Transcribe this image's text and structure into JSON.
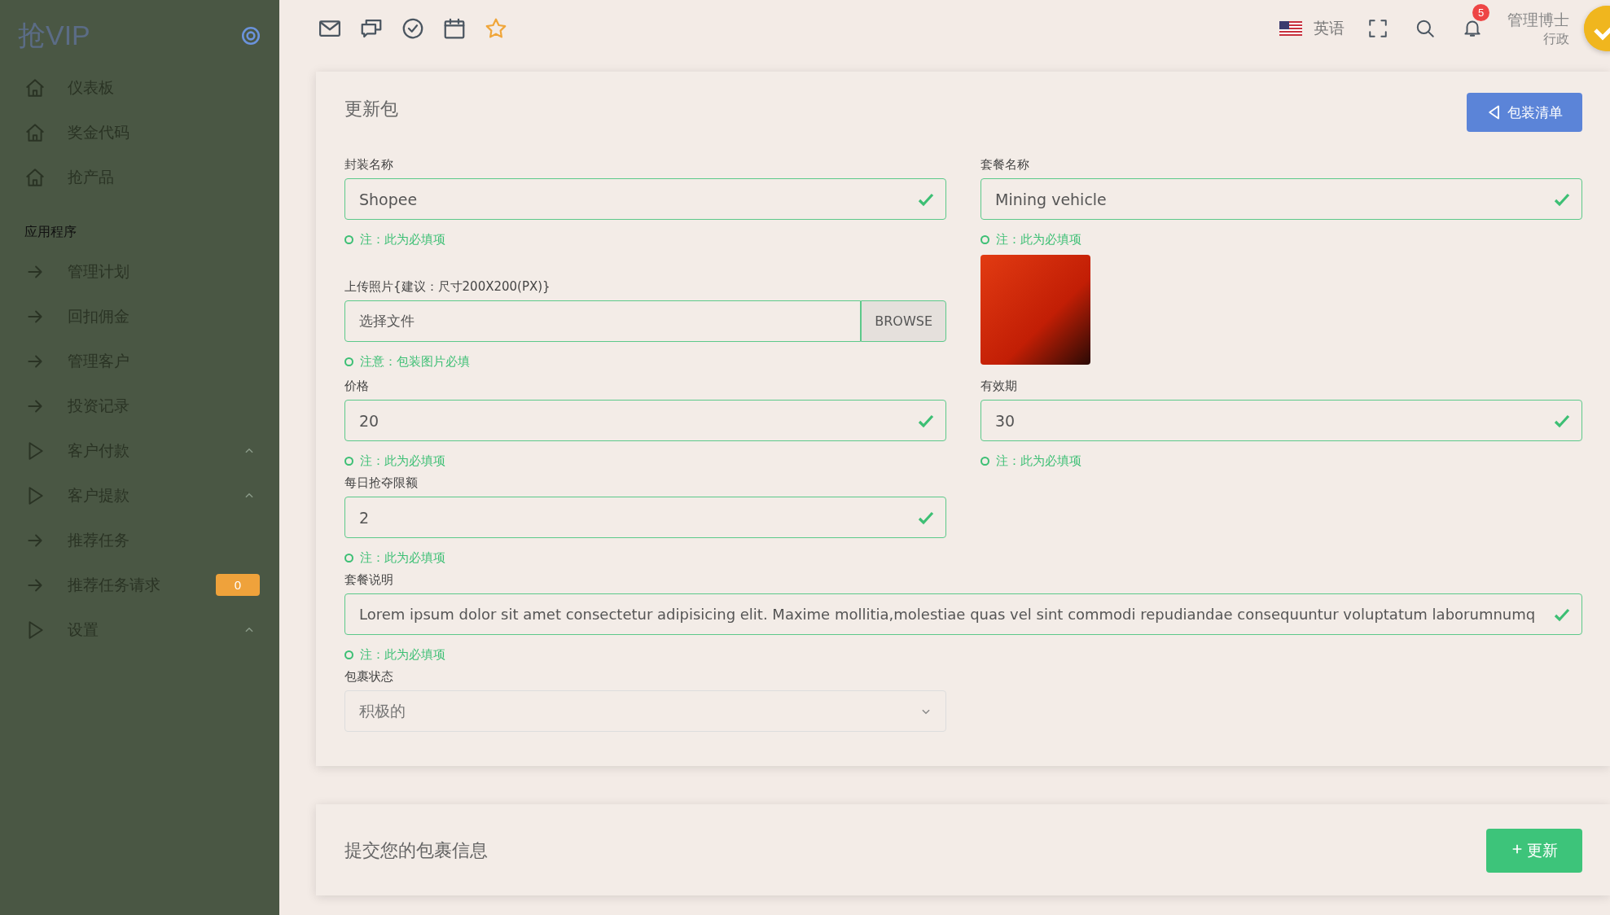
{
  "sidebar": {
    "logo": "抢VIP",
    "main_items": [
      {
        "kind": "home",
        "label": "仪表板"
      },
      {
        "kind": "home",
        "label": "奖金代码"
      },
      {
        "kind": "home",
        "label": "抢产品"
      }
    ],
    "section_title": "应用程序",
    "app_items": [
      {
        "kind": "link",
        "label": "管理计划",
        "has_submenu": false
      },
      {
        "kind": "link",
        "label": "回扣佣金",
        "has_submenu": false
      },
      {
        "kind": "link",
        "label": "管理客户",
        "has_submenu": false
      },
      {
        "kind": "link",
        "label": "投资记录",
        "has_submenu": false
      },
      {
        "kind": "group",
        "label": "客户付款",
        "has_submenu": true
      },
      {
        "kind": "group",
        "label": "客户提款",
        "has_submenu": true
      },
      {
        "kind": "link",
        "label": "推荐任务",
        "has_submenu": false
      },
      {
        "kind": "link",
        "label": "推荐任务请求",
        "has_submenu": false,
        "badge": "0"
      },
      {
        "kind": "group",
        "label": "设置",
        "has_submenu": true
      }
    ]
  },
  "topbar": {
    "language": "英语",
    "notification_count": "5",
    "user_name": "管理博士",
    "user_role": "行政"
  },
  "form_card": {
    "title": "更新包",
    "back_button": "包装清单",
    "rows": [
      [
        {
          "kind": "text",
          "label": "封装名称",
          "value": "Shopee",
          "valid": true,
          "note": "注：此为必填项"
        },
        {
          "kind": "text",
          "label": "套餐名称",
          "value": "Mining vehicle",
          "valid": true,
          "note": "注：此为必填项"
        }
      ],
      [
        {
          "kind": "file",
          "label": "上传照片{建议：尺寸200X200(PX)}",
          "placeholder": "选择文件",
          "button": "BROWSE",
          "valid": true,
          "note": "注意：包装图片必填"
        },
        {
          "kind": "image"
        }
      ],
      [
        {
          "kind": "text",
          "label": "价格",
          "value": "20",
          "valid": true,
          "note": "注：此为必填项"
        },
        {
          "kind": "text",
          "label": "有效期",
          "value": "30",
          "valid": true,
          "note": "注：此为必填项"
        }
      ],
      [
        {
          "kind": "text",
          "label": "每日抢夺限额",
          "value": "2",
          "valid": true,
          "note": "注：此为必填项"
        }
      ],
      [
        {
          "kind": "long_text",
          "label": "套餐说明",
          "value": "Lorem ipsum dolor sit amet consectetur adipisicing elit. Maxime mollitia,molestiae quas vel sint commodi repudiandae consequuntur voluptatum laborumnumq",
          "valid": true,
          "note": "注：此为必填项"
        }
      ],
      [
        {
          "kind": "select",
          "label": "包裹状态",
          "value": "积极的",
          "valid": false
        }
      ]
    ]
  },
  "submit_card": {
    "title": "提交您的包裹信息",
    "button": "更新"
  }
}
